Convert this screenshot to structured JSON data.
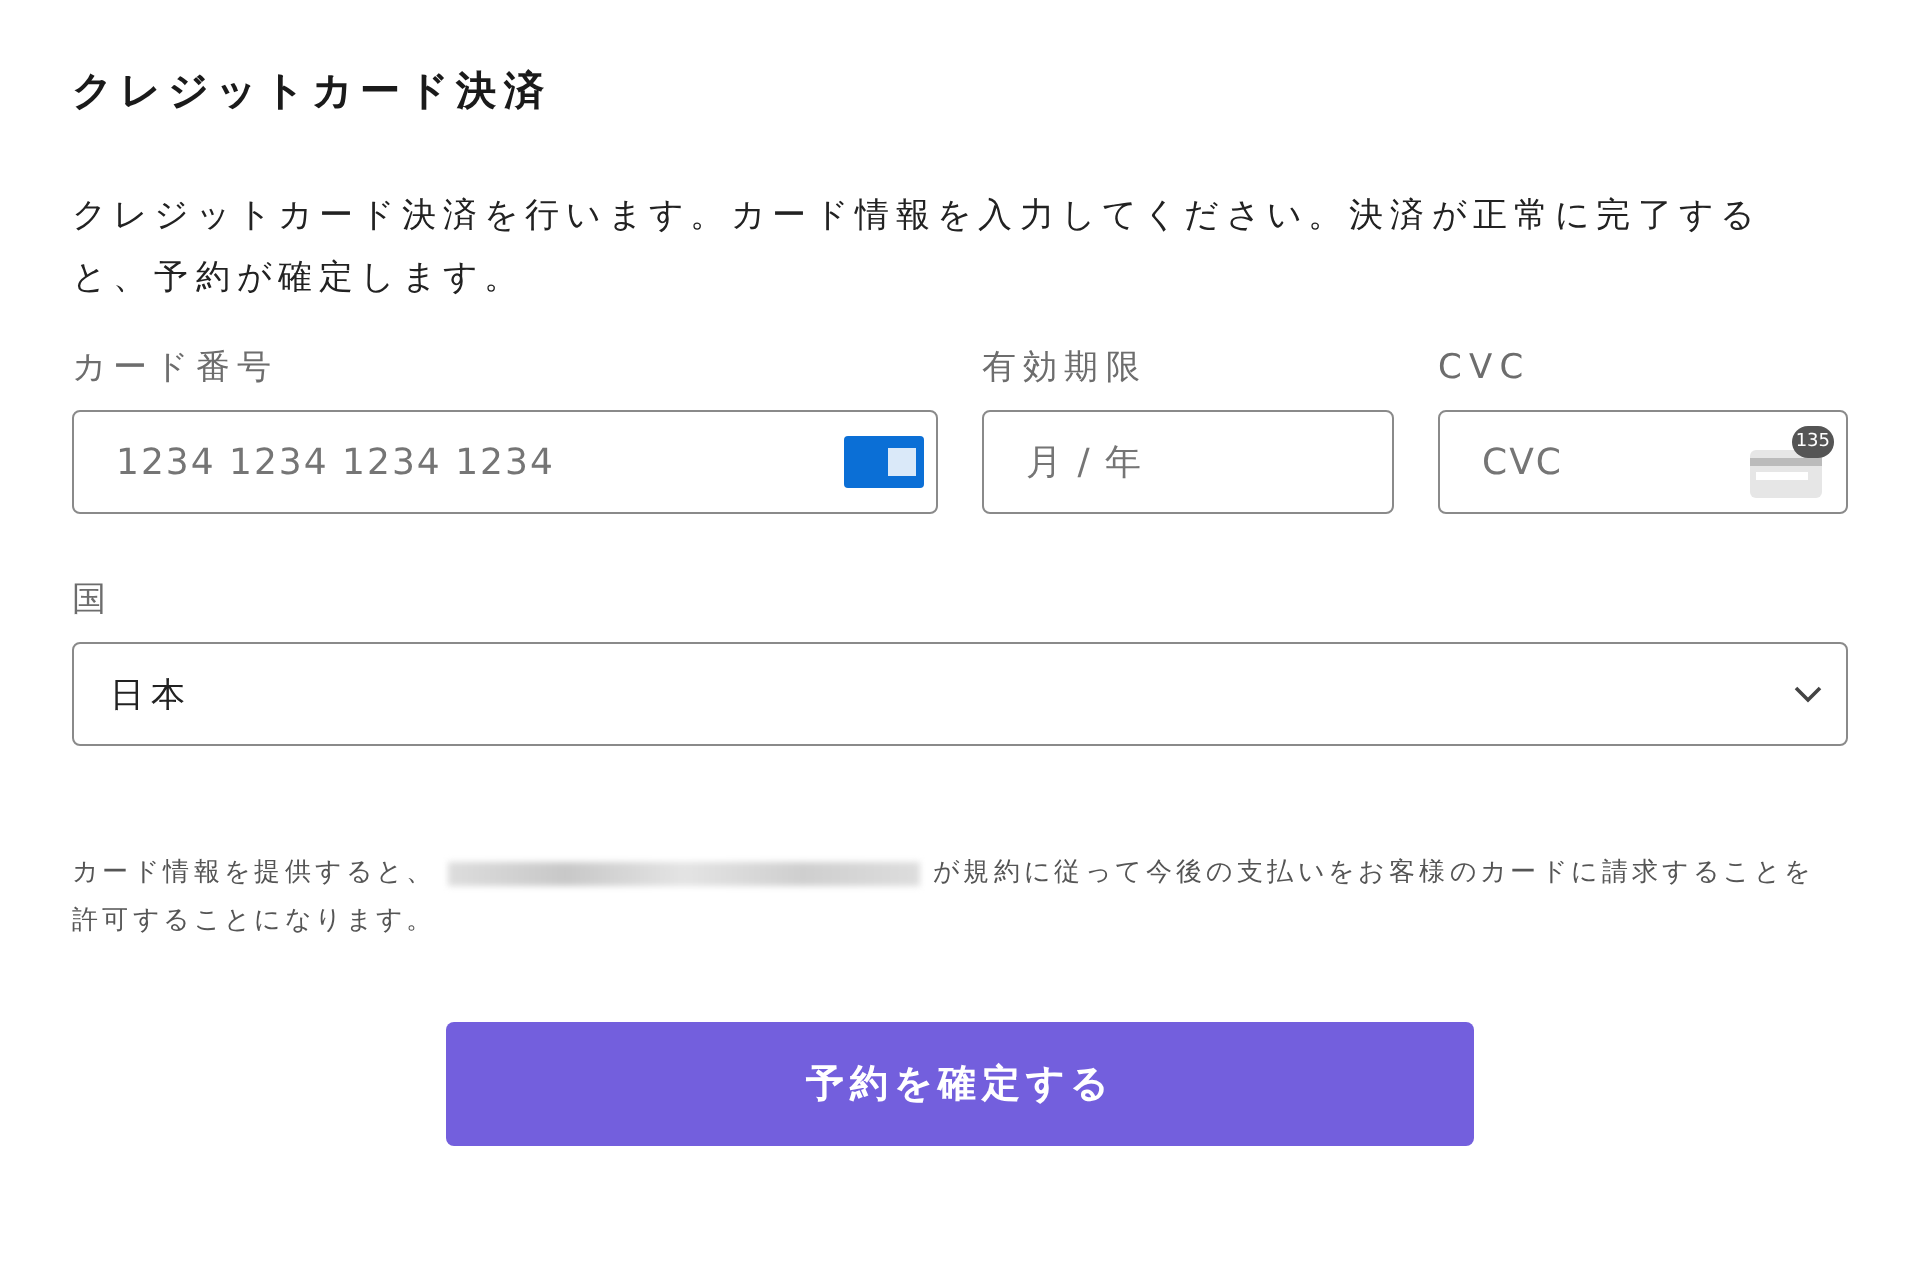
{
  "title": "クレジットカード決済",
  "description": "クレジットカード決済を行います。カード情報を入力してください。決済が正常に完了すると、予約が確定します。",
  "fields": [
    {
      "kind": "card",
      "label": "カード番号",
      "placeholder": "1234 1234 1234 1234"
    },
    {
      "kind": "expiry",
      "label": "有効期限",
      "placeholder": "月 / 年"
    },
    {
      "kind": "cvc",
      "label": "CVC",
      "placeholder": "CVC",
      "badge": "135"
    }
  ],
  "country": {
    "label": "国",
    "value": "日本"
  },
  "notice": {
    "before": "カード情報を提供すると、",
    "after": "が規約に従って今後の支払いをお客様のカードに請求することを",
    "continued": "許可することになります。"
  },
  "submit": "予約を確定する"
}
